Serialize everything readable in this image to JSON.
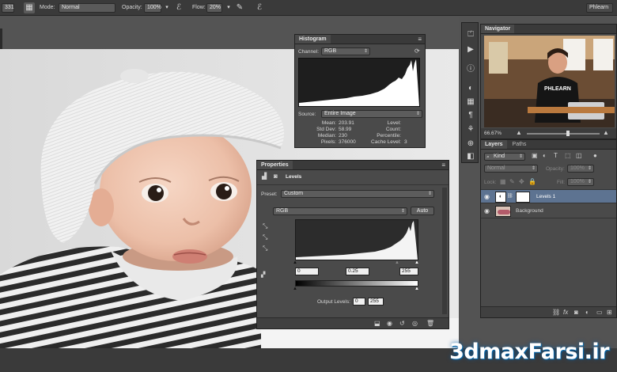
{
  "options_bar": {
    "size_value": "331",
    "mode_label": "Mode:",
    "mode_value": "Normal",
    "opacity_label": "Opacity:",
    "opacity_value": "100%",
    "flow_label": "Flow:",
    "flow_value": "20%",
    "workspace": "Phlearn"
  },
  "histogram": {
    "title": "Histogram",
    "channel_label": "Channel:",
    "channel_value": "RGB",
    "source_label": "Source:",
    "source_value": "Entire Image",
    "stats_left_labels": [
      "Mean:",
      "Std Dev:",
      "Median:",
      "Pixels:"
    ],
    "stats_left_values": [
      "203.91",
      "58.99",
      "230",
      "376000"
    ],
    "stats_right_labels": [
      "Level:",
      "Count:",
      "Percentile:",
      "Cache Level:"
    ],
    "stats_right_values": [
      "",
      "",
      "",
      "3"
    ]
  },
  "properties": {
    "title": "Properties",
    "adjustment": "Levels",
    "preset_label": "Preset:",
    "preset_value": "Custom",
    "channel_value": "RGB",
    "auto_label": "Auto",
    "input_black": "0",
    "input_mid": "0.25",
    "input_white": "255",
    "output_label": "Output Levels:",
    "output_black": "0",
    "output_white": "255"
  },
  "navigator": {
    "title": "Navigator",
    "zoom": "66.67%",
    "shirt_text": "PHLEARN"
  },
  "layers": {
    "tabs": [
      "Layers",
      "Paths"
    ],
    "filter_value": "Kind",
    "blend_value": "Normal",
    "opacity_label": "Opacity:",
    "opacity_value": "100%",
    "lock_label": "Lock:",
    "fill_label": "Fill:",
    "fill_value": "100%",
    "items": [
      {
        "name": "Levels 1",
        "selected": true
      },
      {
        "name": "Background",
        "selected": false
      }
    ]
  },
  "watermark": "3dmaxFarsi.ir",
  "colors": {
    "panel_bg": "#4a4a4a",
    "selected_layer": "#5d7391",
    "watermark_glow": "#0a6fb0"
  }
}
